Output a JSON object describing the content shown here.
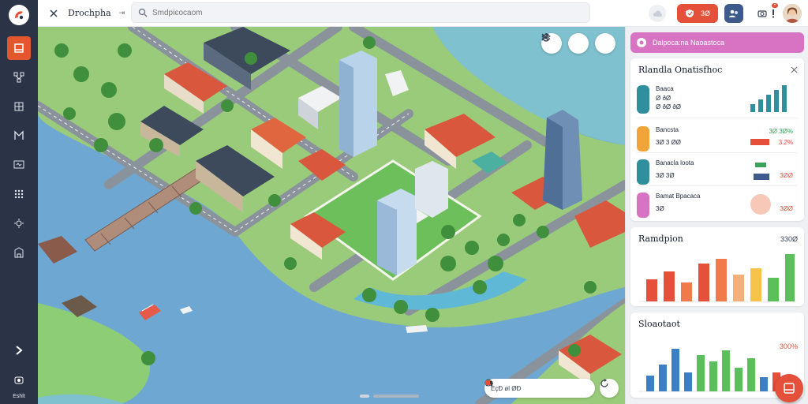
{
  "topbar": {
    "title": "Drochpha",
    "arrows": "⇥",
    "search_placeholder": "Smdpiєocaom",
    "alert_value": "3Ø"
  },
  "sidebar": {
    "bottom_label": "Eshlt"
  },
  "map": {
    "bottom_bar_text": "EçÐ øl ØÐ"
  },
  "panel": {
    "banner_text": "Dalpoca:na Naoastoca",
    "stats_card": {
      "title": "Rlandla Onatisfhoc",
      "rows": [
        {
          "label": "Baaca",
          "value": "Ø ðØ",
          "value2": "Ø ðØ ðØ",
          "right": "",
          "icon_color": "#2f8f9d"
        },
        {
          "label": "Bancsta",
          "value": "3Ø 3  ØØ",
          "value2": "",
          "right": "çØ ØØ",
          "icon_color": "#f0a43a"
        },
        {
          "label": "Banacla loota",
          "value": "3Ø 3Ø",
          "value2": "",
          "right": "çØØ",
          "icon_color": "#2f8f9d"
        },
        {
          "label": "Bamat Bpacaca",
          "value": "3Ø",
          "value2": "",
          "right": "3ØØ",
          "icon_color": "#d873c4"
        }
      ],
      "mini_right_labels": [
        "3Ø 3Ø%",
        "3.2%",
        "3ØØ",
        "3ØØ"
      ]
    },
    "bar_card_1": {
      "title": "Ramdpion",
      "value": "330Ø"
    },
    "bar_card_2": {
      "title": "Sloaotaot",
      "value": "300%"
    }
  },
  "colors": {
    "sidebar": "#2b3447",
    "accent": "#e4503a",
    "banner": "#d873c4",
    "water": "#6fa7d3",
    "grass": "#7cc36a"
  }
}
